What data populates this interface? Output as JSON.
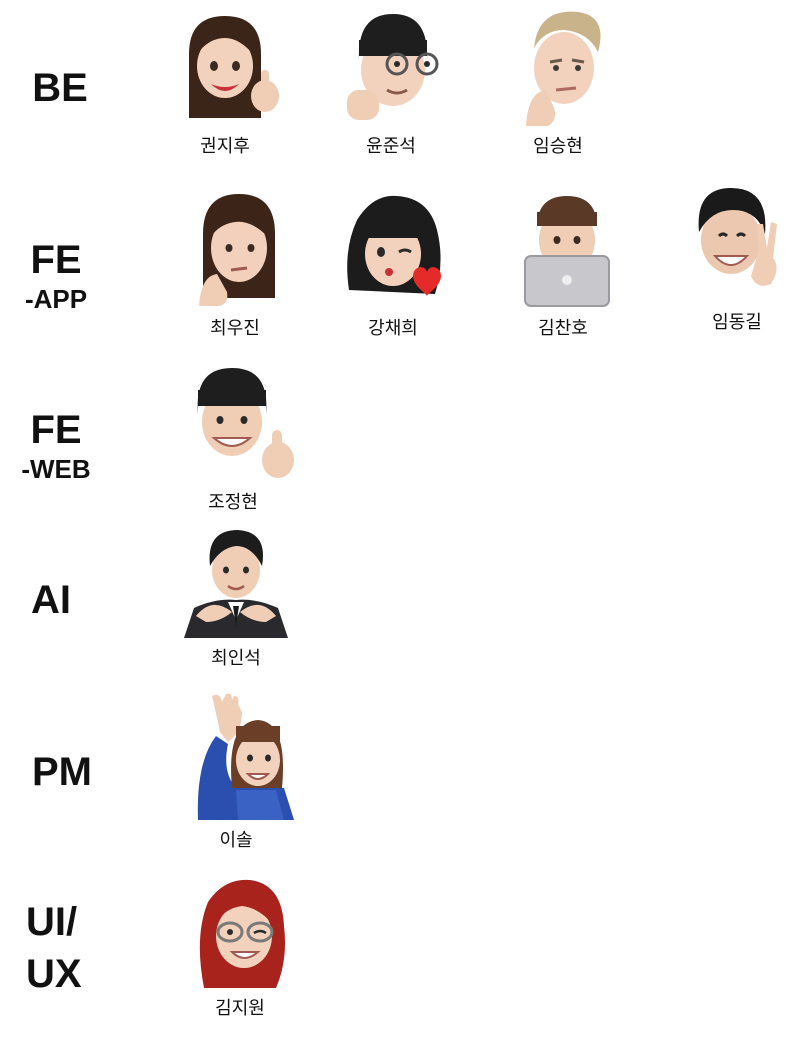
{
  "teams": [
    {
      "key": "be",
      "label": "BE",
      "sub": ""
    },
    {
      "key": "fe-app",
      "label": "FE",
      "sub": "-APP"
    },
    {
      "key": "fe-web",
      "label": "FE",
      "sub": "-WEB"
    },
    {
      "key": "ai",
      "label": "AI",
      "sub": ""
    },
    {
      "key": "pm",
      "label": "PM",
      "sub": ""
    },
    {
      "key": "uiux",
      "label": "UI/",
      "sub": "UX"
    }
  ],
  "members": {
    "be": [
      {
        "name": "권지후",
        "hair": "#3b2418",
        "skin": "#f3d2bd",
        "accessory": "thumbs-up"
      },
      {
        "name": "윤준석",
        "hair": "#1e1e1e",
        "skin": "#f3d2bd",
        "accessory": "glasses"
      },
      {
        "name": "임승현",
        "hair": "#c9b38a",
        "skin": "#f3d2bd",
        "accessory": "thinking"
      }
    ],
    "fe_app": [
      {
        "name": "최우진",
        "hair": "#3d2418",
        "skin": "#f2d0bb",
        "accessory": "thinking"
      },
      {
        "name": "강채희",
        "hair": "#1c1c1c",
        "skin": "#f3d2bd",
        "accessory": "heart"
      },
      {
        "name": "김찬호",
        "hair": "#5a3a26",
        "skin": "#f0cdb5",
        "accessory": "laptop"
      },
      {
        "name": "임동길",
        "hair": "#1a1a1a",
        "skin": "#ecc8b0",
        "accessory": "peace"
      }
    ],
    "fe_web": [
      {
        "name": "조정현",
        "hair": "#1e1e1e",
        "skin": "#f0cdb5",
        "accessory": "thumbs-up"
      }
    ],
    "ai": [
      {
        "name": "최인석",
        "hair": "#1c1c1c",
        "skin": "#f0cdb5",
        "accessory": "heart-hands"
      }
    ],
    "pm": [
      {
        "name": "이솔",
        "hair": "#6b3f27",
        "skin": "#f3d2bd",
        "accessory": "wave"
      }
    ],
    "uiux": [
      {
        "name": "김지원",
        "hair": "#a8231c",
        "skin": "#f3d2bd",
        "accessory": "glasses"
      }
    ]
  }
}
